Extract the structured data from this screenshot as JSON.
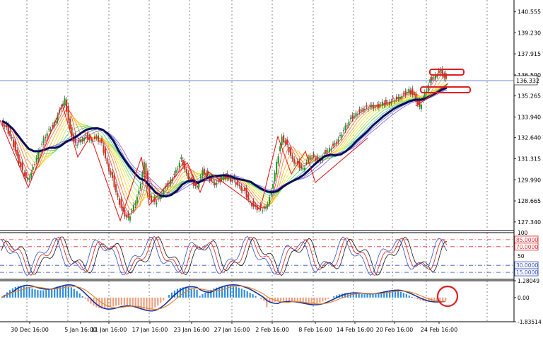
{
  "chart_data": [
    {
      "type": "candlestick",
      "pane": "price",
      "y_ticks": [
        "140.555",
        "139.230",
        "137.915",
        "136.590",
        "135.265",
        "133.940",
        "132.640",
        "131.315",
        "129.990",
        "128.665",
        "127.340"
      ],
      "current_price": "136.332",
      "close_series": [
        133.7,
        133.3,
        132.6,
        131.5,
        130.6,
        130.0,
        130.8,
        131.8,
        132.6,
        133.2,
        133.6,
        134.4,
        135.1,
        133.2,
        132.3,
        132.5,
        132.8,
        132.5,
        132.7,
        132.3,
        131.0,
        130.1,
        128.9,
        128.0,
        127.6,
        128.4,
        129.3,
        131.1,
        128.9,
        128.6,
        129.0,
        129.6,
        130.0,
        130.6,
        131.4,
        130.4,
        129.9,
        129.6,
        130.6,
        130.3,
        129.8,
        129.9,
        130.3,
        130.1,
        130.0,
        129.6,
        129.3,
        128.6,
        128.3,
        128.2,
        128.3,
        129.3,
        131.1,
        132.7,
        132.2,
        131.3,
        131.0,
        130.7,
        131.4,
        131.5,
        131.2,
        131.7,
        132.0,
        132.3,
        132.8,
        133.4,
        133.9,
        134.2,
        134.4,
        134.6,
        134.7,
        134.6,
        134.9,
        134.8,
        135.1,
        135.2,
        135.4,
        135.7,
        135.3,
        134.6,
        135.5,
        136.3,
        136.6,
        136.9,
        136.33
      ],
      "x_ticks": [
        "30 Dec 16:00",
        "5 Jan 16:00",
        "11 Jan 16:00",
        "17 Jan 16:00",
        "23 Jan 16:00",
        "27 Jan 16:00",
        "2 Feb 16:00",
        "8 Feb 16:00",
        "14 Feb 16:00",
        "20 Feb 16:00",
        "24 Feb 16:00"
      ]
    },
    {
      "type": "line",
      "pane": "stochastic",
      "y_ticks": [
        "100",
        "50"
      ],
      "levels": [
        {
          "label": "85.0000",
          "value": 85,
          "color": "#e03030"
        },
        {
          "label": "70.0000",
          "value": 70,
          "color": "#e03030"
        },
        {
          "label": "30.0000",
          "value": 30,
          "color": "#3050c0"
        },
        {
          "label": "15.0000",
          "value": 15,
          "color": "#3050c0"
        }
      ],
      "ylim": [
        0,
        100
      ]
    },
    {
      "type": "histogram",
      "pane": "macd",
      "y_ticks": [
        "1.28049",
        "0.00",
        "-1.83514"
      ],
      "ylim": [
        -1.83514,
        1.28049
      ]
    }
  ],
  "annotations": {
    "circle_color": "#e02020",
    "trendline_color": "#e02020",
    "highlight_box_color": "#e02020"
  },
  "colors": {
    "bull_candle": "#1a9e1a",
    "bear_candle": "#d03020",
    "ma_main": "#0a0a5a",
    "hist_pos": "#2f8ee0",
    "hist_neg": "#f0a080",
    "signal": "#1a2fa0",
    "signal2": "#e08020"
  }
}
